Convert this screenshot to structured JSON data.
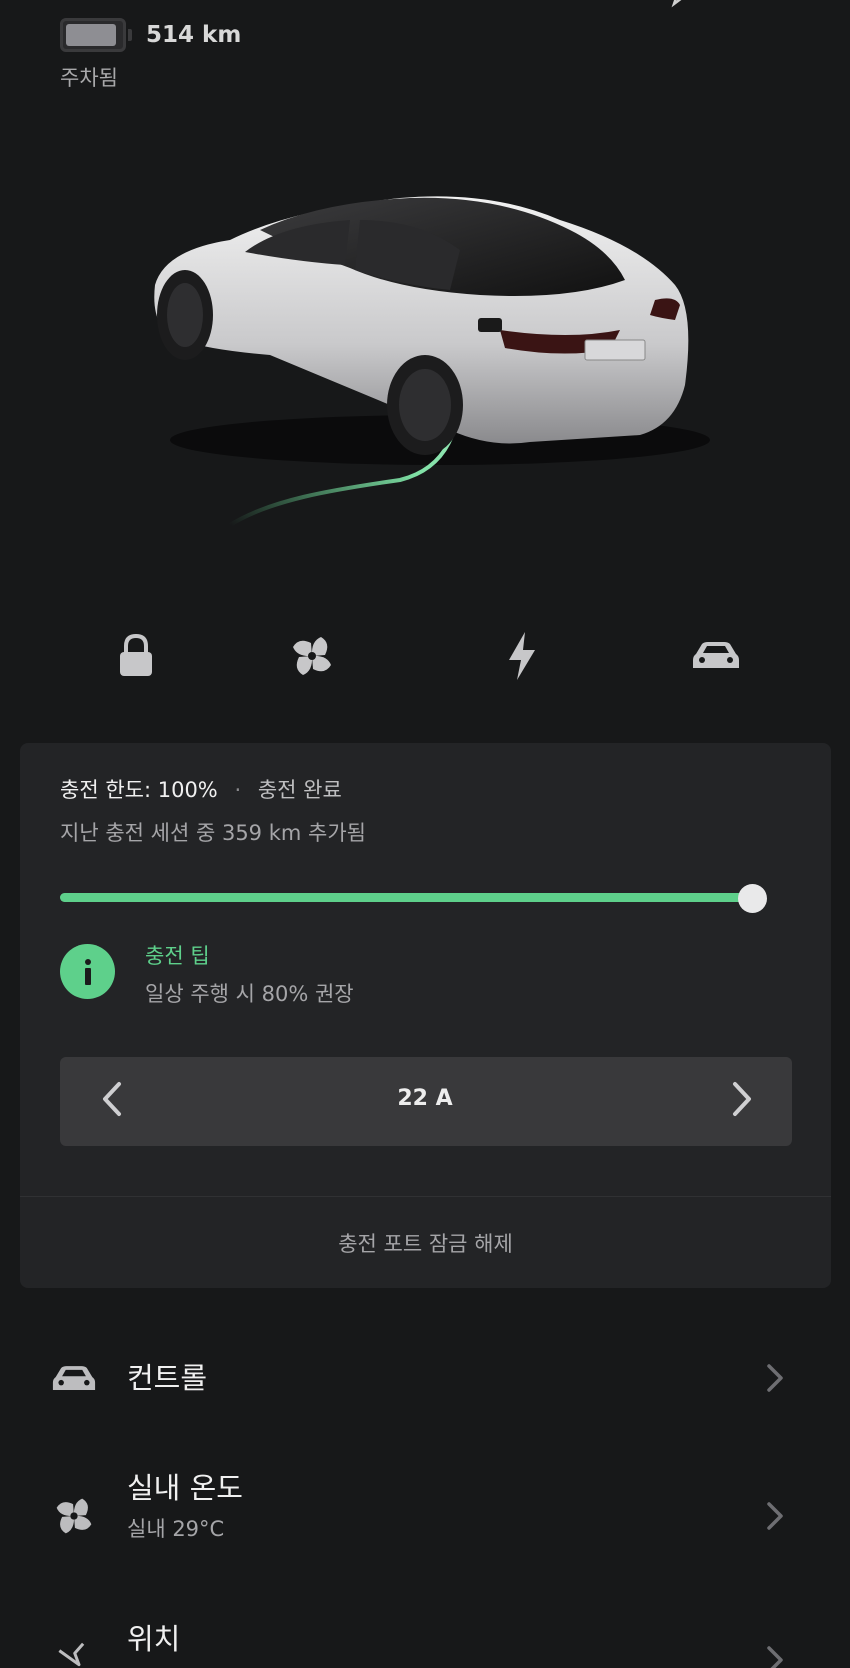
{
  "header": {
    "range": "514 km",
    "status": "주차됨",
    "battery_level": 0.93
  },
  "quick_actions": [
    {
      "name": "lock-icon"
    },
    {
      "name": "fan-icon"
    },
    {
      "name": "bolt-icon"
    },
    {
      "name": "car-icon"
    }
  ],
  "charge": {
    "limit_label": "충전 한도:",
    "limit_value": "100%",
    "separator": "·",
    "state": "충전 완료",
    "session_prefix": "지난 충전 세션 중",
    "session_value": "359 km",
    "session_suffix": "추가됨",
    "slider_level": 1.0,
    "tip_title": "충전 팁",
    "tip_text": "일상 주행 시 80% 권장",
    "amps": "22 A",
    "unlock_port": "충전 포트 잠금 해제"
  },
  "menu": {
    "controls": {
      "title": "컨트롤"
    },
    "climate": {
      "title": "실내 온도",
      "subtitle": "실내 29°C"
    },
    "location": {
      "title": "위치"
    }
  },
  "colors": {
    "accent_green": "#5ed08b",
    "background": "#171819",
    "card": "#232426"
  }
}
